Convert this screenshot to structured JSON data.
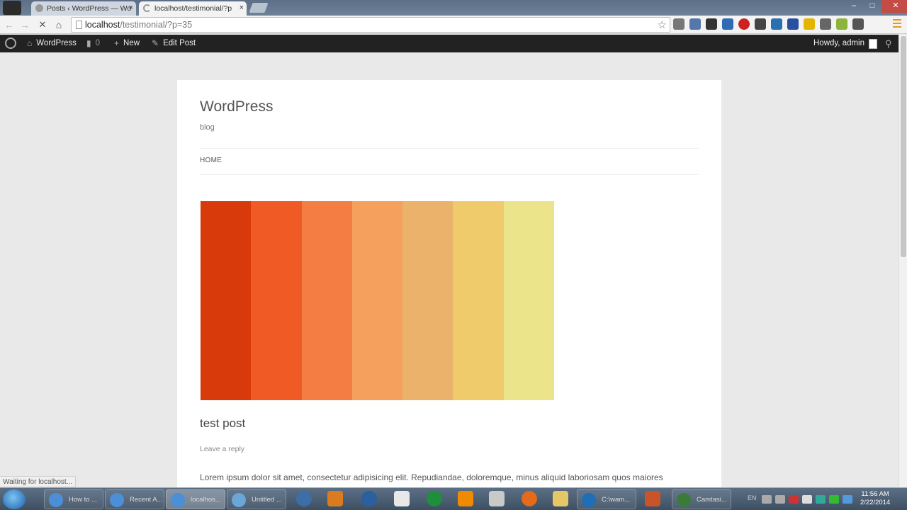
{
  "browser": {
    "tabs": [
      {
        "label": "Posts ‹ WordPress — Wo",
        "close": "×"
      },
      {
        "label": "localhost/testimonial/?p",
        "close": "×"
      }
    ],
    "window_controls": {
      "minimize": "–",
      "maximize": "□",
      "close": "✕"
    },
    "url_host": "localhost",
    "url_path": "/testimonial/?p=35",
    "status_text": "Waiting for localhost..."
  },
  "adminbar": {
    "site_label": "WordPress",
    "comments_count": "0",
    "new_label": "New",
    "edit_label": "Edit Post",
    "howdy_label": "Howdy, admin"
  },
  "site": {
    "title": "WordPress",
    "description": "blog",
    "nav_home": "HOME"
  },
  "post": {
    "title": "test post",
    "leave_reply": "Leave a reply",
    "excerpt": "Lorem ipsum dolor sit amet, consectetur adipisicing elit. Repudiandae, doloremque, minus aliquid laboriosam quos maiores"
  },
  "featured_image": {
    "stripes": [
      "#d93a0c",
      "#f05a24",
      "#f47d44",
      "#f6a05e",
      "#ebb26c",
      "#efcb6c",
      "#ece48a"
    ]
  },
  "taskbar": {
    "buttons": [
      {
        "label": "How to ...",
        "color": "#4a8fd8"
      },
      {
        "label": "Recent A...",
        "color": "#4a8fd8"
      },
      {
        "label": "localhos...",
        "color": "#4a8fd8"
      },
      {
        "label": "Untitled ...",
        "color": "#6aa6d8"
      },
      {
        "label": "C:\\wam...",
        "color": "#1e6fb8"
      },
      {
        "label": "Camtasi...",
        "color": "#3c7a3c"
      }
    ],
    "clock_time": "11:56 AM",
    "clock_date": "2/22/2014",
    "lang": "EN"
  }
}
